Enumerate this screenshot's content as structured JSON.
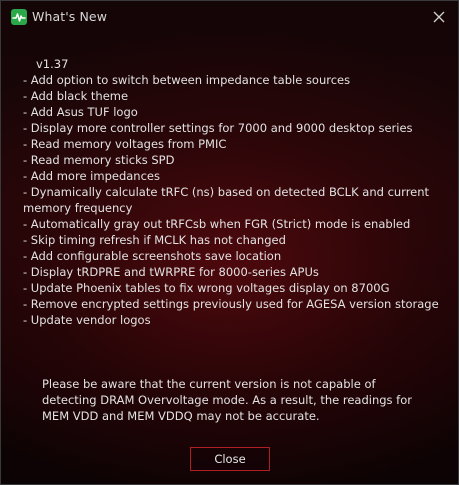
{
  "window": {
    "title": "What's New",
    "app_icon": "pulse-icon",
    "close_icon": "close-icon"
  },
  "release": {
    "version": "v1.37",
    "changes": [
      "- Add option to switch between impedance table sources",
      "- Add black theme",
      "- Add Asus TUF logo",
      "- Display more controller settings for 7000 and 9000 desktop series",
      "- Read memory voltages from PMIC",
      "- Read memory sticks SPD",
      "- Add more impedances",
      "- Dynamically calculate tRFC (ns) based on detected BCLK and current memory frequency",
      "- Automatically gray out tRFCsb when FGR (Strict) mode is enabled",
      "- Skip timing refresh if MCLK has not changed",
      "- Add configurable screenshots save location",
      "- Display tRDPRE and tWRPRE for 8000-series APUs",
      "- Update Phoenix tables to fix wrong voltages display on 8700G",
      "- Remove encrypted settings previously used for AGESA version storage",
      "- Update vendor logos"
    ]
  },
  "notice": "Please be aware that the current version is not capable of detecting DRAM Overvoltage mode. As a result, the readings for MEM VDD and MEM VDDQ may not be accurate.",
  "buttons": {
    "close_label": "Close"
  },
  "colors": {
    "accent": "#b01e25",
    "app_icon_bg": "#2aa84a",
    "background": "#1d0608"
  }
}
